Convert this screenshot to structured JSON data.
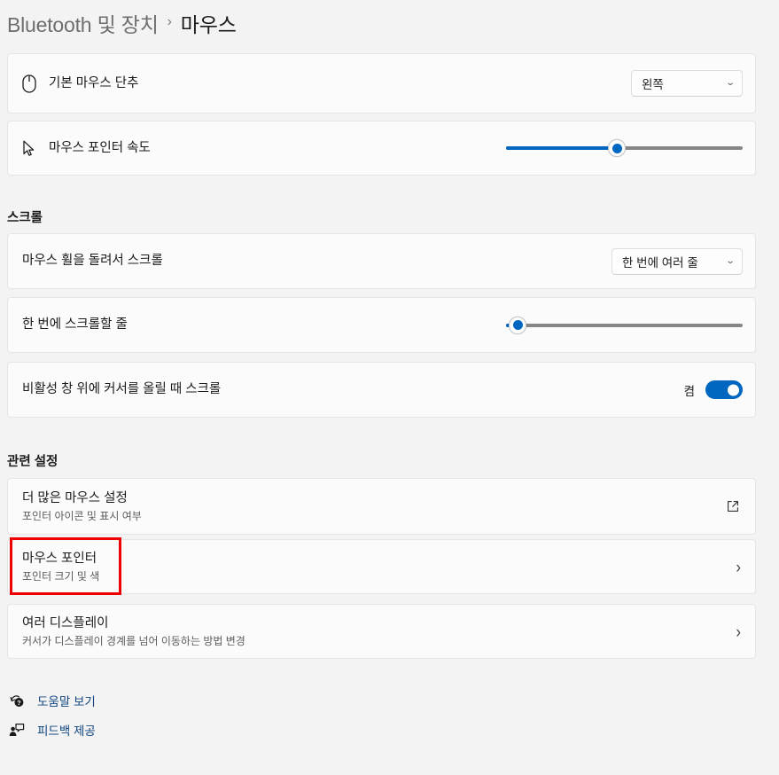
{
  "breadcrumb": {
    "parent": "Bluetooth 및 장치",
    "separator": "›",
    "current": "마우스"
  },
  "settings": {
    "primary_button": {
      "icon": "mouse-icon",
      "label": "기본 마우스 단추",
      "dropdown_value": "왼쪽",
      "chevron": "⌄"
    },
    "pointer_speed": {
      "icon": "cursor-arrow-icon",
      "label": "마우스 포인터 속도",
      "slider_percent": 47
    }
  },
  "scroll_section": {
    "header": "스크롤",
    "wheel_scroll": {
      "label": "마우스 휠을 돌려서 스크롤",
      "dropdown_value": "한 번에 여러 줄",
      "chevron": "⌄"
    },
    "lines_to_scroll": {
      "label": "한 번에 스크롤할 줄",
      "slider_percent": 5
    },
    "inactive_window_scroll": {
      "label": "비활성 창 위에 커서를 올릴 때 스크롤",
      "toggle_state_label": "켬",
      "toggle_on": true
    }
  },
  "related_section": {
    "header": "관련 설정",
    "items": [
      {
        "title": "더 많은 마우스 설정",
        "subtitle": "포인터 아이콘 및 표시 여부",
        "action_icon": "external-link-icon"
      },
      {
        "title": "마우스 포인터",
        "subtitle": "포인터 크기 및 색",
        "action_icon": "chevron-right-icon",
        "chevron": "›",
        "highlighted": true
      },
      {
        "title": "여러 디스플레이",
        "subtitle": "커서가 디스플레이 경계를 넘어 이동하는 방법 변경",
        "action_icon": "chevron-right-icon",
        "chevron": "›"
      }
    ]
  },
  "footer": {
    "help": {
      "icon": "help-question-icon",
      "label": "도움말 보기"
    },
    "feedback": {
      "icon": "feedback-person-icon",
      "label": "피드백 제공"
    }
  },
  "colors": {
    "accent": "#0067C0",
    "link": "#10457F",
    "page_bg": "#F3F3F3",
    "card_bg": "#FBFBFB",
    "annotation": "#EE0000"
  }
}
